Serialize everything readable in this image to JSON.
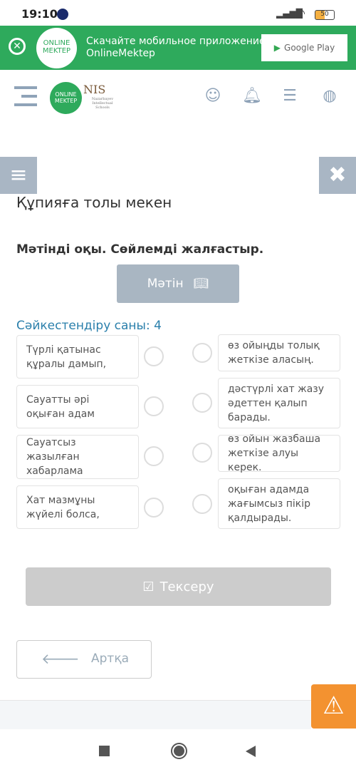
{
  "status_bar": {
    "time": "19:10",
    "battery": "50"
  },
  "banner": {
    "logo_text": "ONLINE MEKTEP",
    "text_line1": "Скачайте мобильное приложение",
    "text_line2": "OnlineMektep",
    "store_button": "Google Play"
  },
  "header": {
    "logo_text": "ONLINE MEKTEP",
    "partner_logo": "NIS",
    "partner_sub": "Nazarbayev Intellectual Schools",
    "icons": [
      "support-icon",
      "bell-icon",
      "list-icon",
      "globe-icon"
    ]
  },
  "lesson": {
    "title": "Құпияға толы мекен",
    "instruction": "Мәтінді оқы. Сөйлемді жалғастыр.",
    "text_button": "Мәтін",
    "match_count": "Сәйкестендіру саны: 4"
  },
  "left_items": [
    "Түрлі қатынас құралы дамып,",
    "Сауатты әрі оқыған адам",
    "Сауатсыз жазылған хабарлама",
    "Хат мазмұны жүйелі болса,"
  ],
  "right_items": [
    "өз ойыңды толық жеткізе аласың.",
    "дәстүрлі хат жазу әдеттен қалып барады.",
    "өз ойын жазбаша жеткізе алуы керек.",
    "оқыған адамда жағымсыз пікір қалдырады."
  ],
  "actions": {
    "check": "Тексеру",
    "back": "Артқа"
  },
  "colors": {
    "banner": "#2eaa5c",
    "accent": "#2a7fab",
    "warning": "#f39230",
    "disabled": "#cccccc"
  }
}
